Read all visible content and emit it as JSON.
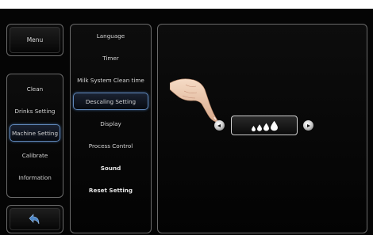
{
  "left_nav": {
    "menu_label": "Menu",
    "items": [
      {
        "label": "Clean"
      },
      {
        "label": "Drinks Setting"
      },
      {
        "label": "Machine Setting"
      },
      {
        "label": "Calibrate"
      },
      {
        "label": "Information"
      }
    ],
    "selected_item": "Machine Setting",
    "back_icon": "back-arrow-icon"
  },
  "settings_list": {
    "items": [
      {
        "label": "Language"
      },
      {
        "label": "Timer"
      },
      {
        "label": "Milk System Clean time"
      },
      {
        "label": "Descaling Setting"
      },
      {
        "label": "Display"
      },
      {
        "label": "Process Control"
      },
      {
        "label": "Sound"
      },
      {
        "label": "Reset Setting"
      }
    ],
    "selected_item": "Descaling Setting"
  },
  "descaling": {
    "water_hardness_level": 4,
    "max_level": 4,
    "left_icon": "arrow-left-icon",
    "right_icon": "arrow-right-icon",
    "level_icon": "water-drop-icon",
    "pointer_icon": "pointing-hand-icon"
  },
  "colors": {
    "background": "#050505",
    "panel_border": "#6a6a6a",
    "selected_border": "#5f86b8",
    "text": "#d4d4d4",
    "back_arrow": "#4d86c6"
  }
}
